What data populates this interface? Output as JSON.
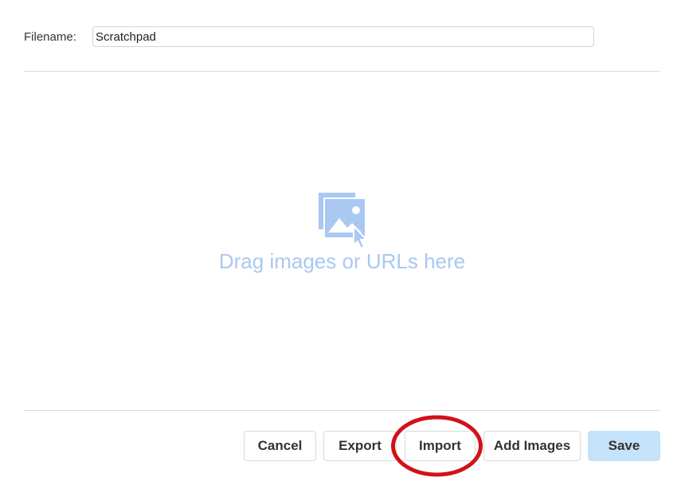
{
  "filename": {
    "label": "Filename:",
    "value": "Scratchpad"
  },
  "dropzone": {
    "icon": "image-drop-icon",
    "text": "Drag images or URLs here",
    "color": "#a9c8f2"
  },
  "buttons": {
    "cancel": "Cancel",
    "export": "Export",
    "import": "Import",
    "add_images": "Add Images",
    "save": "Save"
  },
  "colors": {
    "save_bg": "#c4e3fb",
    "highlight": "#d0121b",
    "icon_blue": "#a9c8f2"
  }
}
